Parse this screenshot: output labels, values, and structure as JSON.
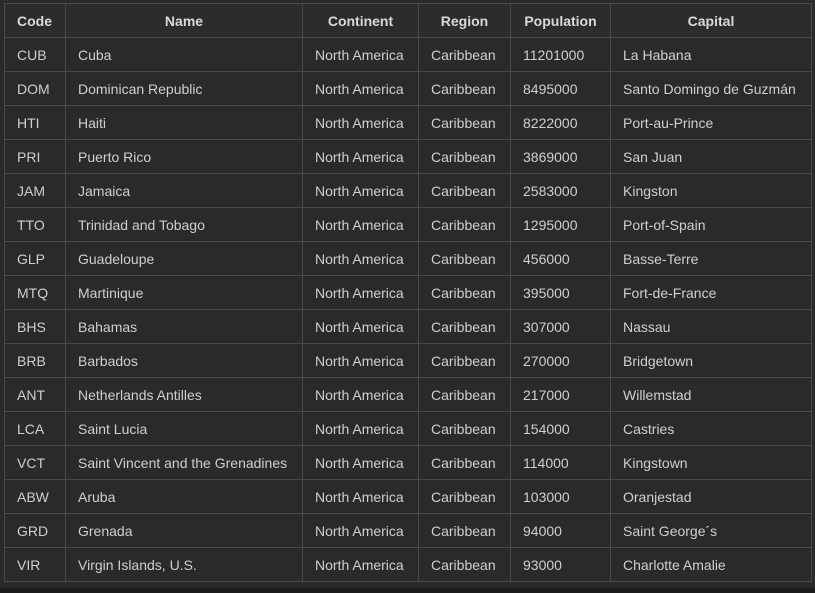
{
  "table": {
    "headers": [
      "Code",
      "Name",
      "Continent",
      "Region",
      "Population",
      "Capital"
    ],
    "rows": [
      [
        "CUB",
        "Cuba",
        "North America",
        "Caribbean",
        "11201000",
        "La Habana"
      ],
      [
        "DOM",
        "Dominican Republic",
        "North America",
        "Caribbean",
        "8495000",
        "Santo Domingo de Guzmán"
      ],
      [
        "HTI",
        "Haiti",
        "North America",
        "Caribbean",
        "8222000",
        "Port-au-Prince"
      ],
      [
        "PRI",
        "Puerto Rico",
        "North America",
        "Caribbean",
        "3869000",
        "San Juan"
      ],
      [
        "JAM",
        "Jamaica",
        "North America",
        "Caribbean",
        "2583000",
        "Kingston"
      ],
      [
        "TTO",
        "Trinidad and Tobago",
        "North America",
        "Caribbean",
        "1295000",
        "Port-of-Spain"
      ],
      [
        "GLP",
        "Guadeloupe",
        "North America",
        "Caribbean",
        "456000",
        "Basse-Terre"
      ],
      [
        "MTQ",
        "Martinique",
        "North America",
        "Caribbean",
        "395000",
        "Fort-de-France"
      ],
      [
        "BHS",
        "Bahamas",
        "North America",
        "Caribbean",
        "307000",
        "Nassau"
      ],
      [
        "BRB",
        "Barbados",
        "North America",
        "Caribbean",
        "270000",
        "Bridgetown"
      ],
      [
        "ANT",
        "Netherlands Antilles",
        "North America",
        "Caribbean",
        "217000",
        "Willemstad"
      ],
      [
        "LCA",
        "Saint Lucia",
        "North America",
        "Caribbean",
        "154000",
        "Castries"
      ],
      [
        "VCT",
        "Saint Vincent and the Grenadines",
        "North America",
        "Caribbean",
        "114000",
        "Kingstown"
      ],
      [
        "ABW",
        "Aruba",
        "North America",
        "Caribbean",
        "103000",
        "Oranjestad"
      ],
      [
        "GRD",
        "Grenada",
        "North America",
        "Caribbean",
        "94000",
        "Saint George´s"
      ],
      [
        "VIR",
        "Virgin Islands, U.S.",
        "North America",
        "Caribbean",
        "93000",
        "Charlotte Amalie"
      ]
    ]
  }
}
